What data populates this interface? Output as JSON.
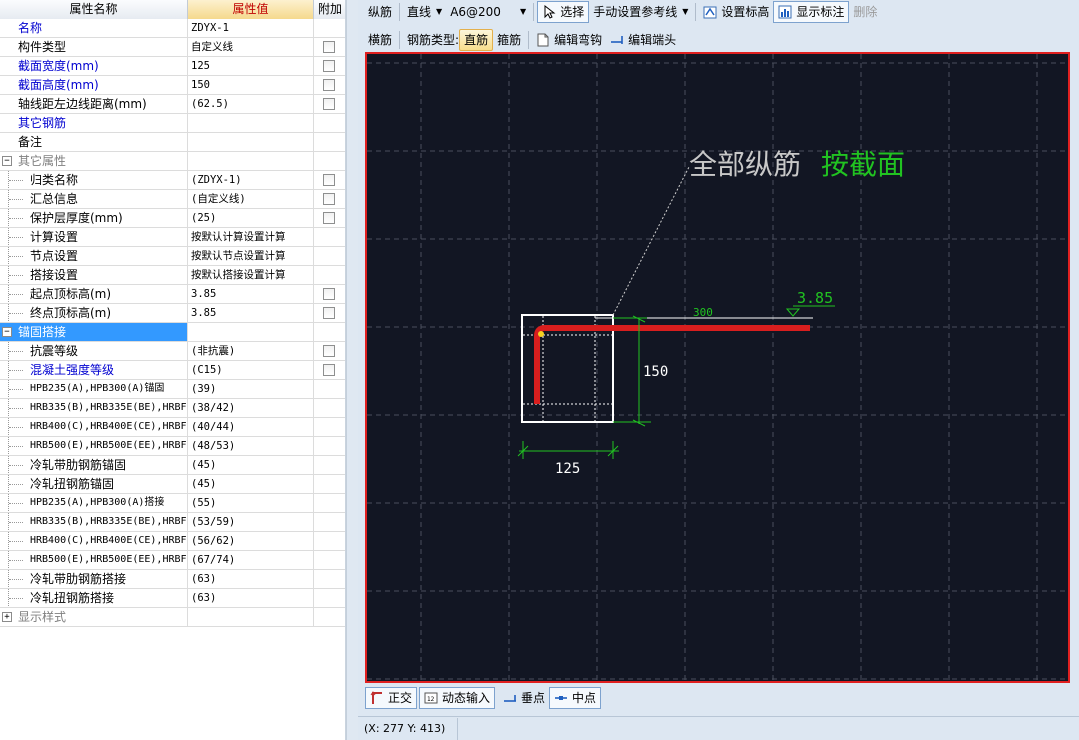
{
  "grid": {
    "headers": {
      "name": "属性名称",
      "value": "属性值",
      "add": "附加"
    },
    "rows": [
      {
        "name": "名称",
        "value": "ZDYX-1",
        "level": 0,
        "color": "blue",
        "check": false
      },
      {
        "name": "构件类型",
        "value": "自定义线",
        "level": 0,
        "color": "black",
        "check": true
      },
      {
        "name": "截面宽度(mm)",
        "value": "125",
        "level": 0,
        "color": "blue",
        "check": true
      },
      {
        "name": "截面高度(mm)",
        "value": "150",
        "level": 0,
        "color": "blue",
        "check": true
      },
      {
        "name": "轴线距左边线距离(mm)",
        "value": "(62.5)",
        "level": 0,
        "color": "black",
        "check": true
      },
      {
        "name": "其它钢筋",
        "value": "",
        "level": 0,
        "color": "blue",
        "check": false
      },
      {
        "name": "备注",
        "value": "",
        "level": 0,
        "color": "black",
        "check": false
      },
      {
        "name": "其它属性",
        "value": "",
        "level": 0,
        "color": "gray",
        "check": false,
        "group": "minus"
      },
      {
        "name": "归类名称",
        "value": "(ZDYX-1)",
        "level": 1,
        "color": "black",
        "check": true
      },
      {
        "name": "汇总信息",
        "value": "(自定义线)",
        "level": 1,
        "color": "black",
        "check": true
      },
      {
        "name": "保护层厚度(mm)",
        "value": "(25)",
        "level": 1,
        "color": "black",
        "check": true
      },
      {
        "name": "计算设置",
        "value": "按默认计算设置计算",
        "level": 1,
        "color": "black",
        "check": false
      },
      {
        "name": "节点设置",
        "value": "按默认节点设置计算",
        "level": 1,
        "color": "black",
        "check": false
      },
      {
        "name": "搭接设置",
        "value": "按默认搭接设置计算",
        "level": 1,
        "color": "black",
        "check": false
      },
      {
        "name": "起点顶标高(m)",
        "value": "3.85",
        "level": 1,
        "color": "black",
        "check": true
      },
      {
        "name": "终点顶标高(m)",
        "value": "3.85",
        "level": 1,
        "color": "black",
        "check": true
      },
      {
        "name": "锚固搭接",
        "value": "",
        "level": 0,
        "color": "white",
        "check": false,
        "group": "minus",
        "selected": true
      },
      {
        "name": "抗震等级",
        "value": "(非抗震)",
        "level": 1,
        "color": "black",
        "check": true
      },
      {
        "name": "混凝土强度等级",
        "value": "(C15)",
        "level": 1,
        "color": "blue",
        "check": true
      },
      {
        "name": "HPB235(A),HPB300(A)锚固",
        "value": "(39)",
        "level": 1,
        "color": "black",
        "check": false,
        "small": true
      },
      {
        "name": "HRB335(B),HRB335E(BE),HRBF",
        "value": "(38/42)",
        "level": 1,
        "color": "black",
        "check": false,
        "small": true
      },
      {
        "name": "HRB400(C),HRB400E(CE),HRBF",
        "value": "(40/44)",
        "level": 1,
        "color": "black",
        "check": false,
        "small": true
      },
      {
        "name": "HRB500(E),HRB500E(EE),HRBF",
        "value": "(48/53)",
        "level": 1,
        "color": "black",
        "check": false,
        "small": true
      },
      {
        "name": "冷轧带肋钢筋锚固",
        "value": "(45)",
        "level": 1,
        "color": "black",
        "check": false
      },
      {
        "name": "冷轧扭钢筋锚固",
        "value": "(45)",
        "level": 1,
        "color": "black",
        "check": false
      },
      {
        "name": "HPB235(A),HPB300(A)搭接",
        "value": "(55)",
        "level": 1,
        "color": "black",
        "check": false,
        "small": true
      },
      {
        "name": "HRB335(B),HRB335E(BE),HRBF",
        "value": "(53/59)",
        "level": 1,
        "color": "black",
        "check": false,
        "small": true
      },
      {
        "name": "HRB400(C),HRB400E(CE),HRBF",
        "value": "(56/62)",
        "level": 1,
        "color": "black",
        "check": false,
        "small": true
      },
      {
        "name": "HRB500(E),HRB500E(EE),HRBF",
        "value": "(67/74)",
        "level": 1,
        "color": "black",
        "check": false,
        "small": true
      },
      {
        "name": "冷轧带肋钢筋搭接",
        "value": "(63)",
        "level": 1,
        "color": "black",
        "check": false
      },
      {
        "name": "冷轧扭钢筋搭接",
        "value": "(63)",
        "level": 1,
        "color": "black",
        "check": false
      },
      {
        "name": "显示样式",
        "value": "",
        "level": 0,
        "color": "gray",
        "check": false,
        "group": "plus"
      }
    ]
  },
  "toolbar1": {
    "rebar_label": "纵筋",
    "line_type": "直线",
    "spec": "A6@200",
    "select_label": "选择",
    "manual_ref_label": "手动设置参考线",
    "set_elev_label": "设置标高",
    "show_dim_label": "显示标注",
    "delete_label": "删除"
  },
  "toolbar2": {
    "horizontal_label": "横筋",
    "type_label": "钢筋类型:",
    "straight_label": "直筋",
    "stirrup_label": "箍筋",
    "edit_hook_label": "编辑弯钩",
    "edit_end_label": "编辑端头"
  },
  "canvas": {
    "annotation_main": "全部纵筋",
    "annotation_green": "按截面",
    "elevation": "3.85",
    "length": "300",
    "height_dim": "150",
    "width_dim": "125"
  },
  "snap_bar": {
    "ortho_label": "正交",
    "dynamic_input_label": "动态输入",
    "perpendicular_label": "垂点",
    "midpoint_label": "中点"
  },
  "status": {
    "coords": "(X: 277 Y: 413)"
  },
  "colors": {
    "canvas_bg": "#121623",
    "rebar": "#d81e1e",
    "dim_green": "#21c321",
    "frame_red": "#e02020"
  }
}
